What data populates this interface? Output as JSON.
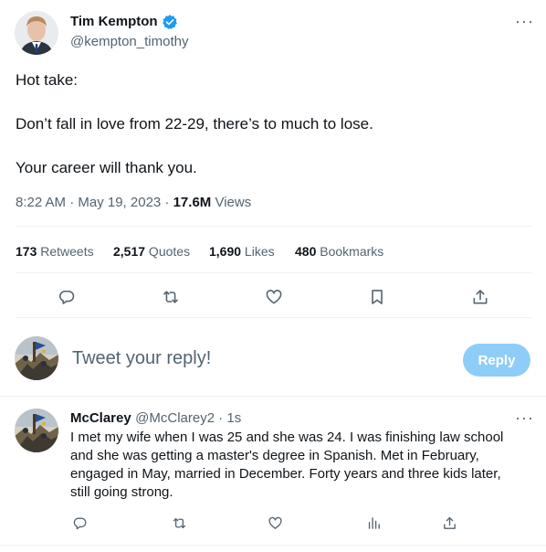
{
  "tweet": {
    "author_name": "Tim Kempton",
    "author_handle": "@kempton_timothy",
    "more_label": "···",
    "text_lines": [
      "Hot take:",
      "Don’t fall in love from 22-29, there’s to much to lose.",
      "Your career will thank you."
    ],
    "time": "8:22 AM · May 19, 2023 · ",
    "views_count": "17.6M",
    "views_label": " Views",
    "stats": {
      "retweets_count": "173",
      "retweets_label": " Retweets",
      "quotes_count": "2,517",
      "quotes_label": " Quotes",
      "likes_count": "1,690",
      "likes_label": " Likes",
      "bookmarks_count": "480",
      "bookmarks_label": " Bookmarks"
    },
    "actions": [
      "reply-icon",
      "retweet-icon",
      "like-icon",
      "bookmark-icon",
      "share-icon"
    ]
  },
  "composer": {
    "placeholder": "Tweet your reply!",
    "reply_button": "Reply"
  },
  "reply": {
    "author_name": "McClarey",
    "author_handle": "@McClarey2 · 1s",
    "more_label": "···",
    "text_lines": [
      "I met my wife when I was 25 and she was 24.  I was finishing law school",
      "and she was getting a master's degree in Spanish.  Met in February,",
      "engaged in May, married in December.  Forty years and three kids later,",
      "still going strong."
    ],
    "actions": [
      "reply-icon",
      "retweet-icon",
      "like-icon",
      "views-icon",
      "share-icon"
    ]
  },
  "colors": {
    "text": "#0f1419",
    "secondary": "#536471",
    "divider": "#eff3f4",
    "verified": "#1d9bf0",
    "reply_button_bg": "#8ecdf8"
  }
}
